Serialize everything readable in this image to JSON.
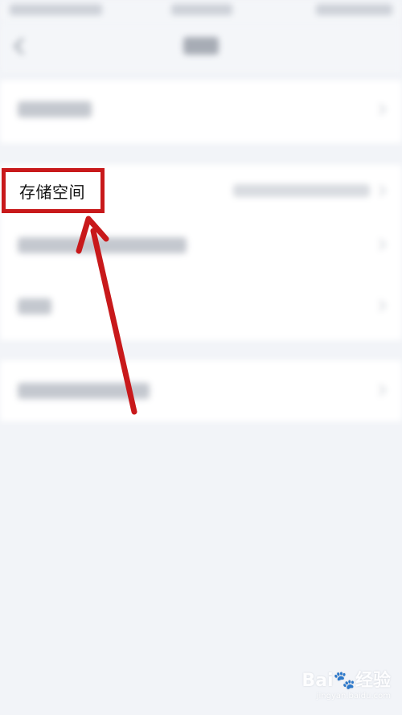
{
  "highlight": {
    "label": "存储空间",
    "border_color": "#c8191b"
  },
  "arrow": {
    "color": "#c8191b"
  },
  "watermark": {
    "brand": "Bai",
    "brand_suffix": "经验",
    "sub": "jingyan.baidu.com"
  },
  "icons": [
    "back-icon",
    "chevron-right-icon",
    "baidu-paw-logo"
  ]
}
